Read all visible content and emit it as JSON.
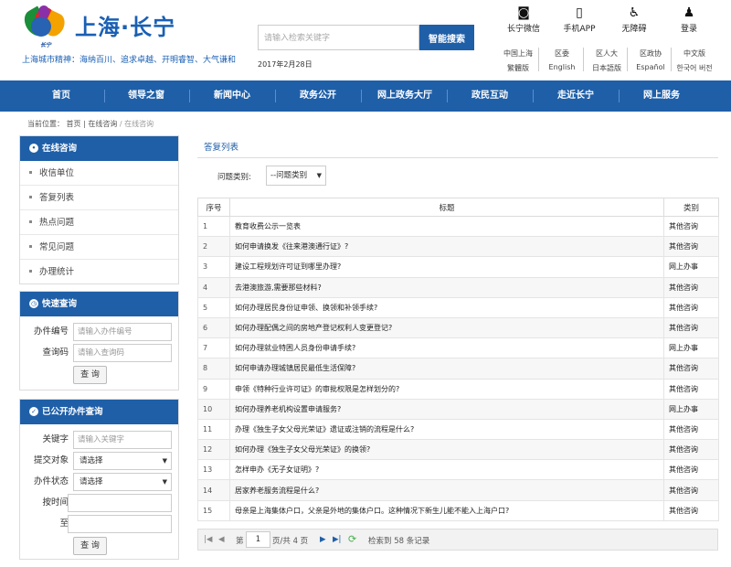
{
  "header": {
    "logo_brand": "长宁",
    "logo_text": "上海·长宁",
    "slogan": "上海城市精神：海纳百川、追求卓越、开明睿智、大气谦和",
    "search_placeholder": "请输入检索关键字",
    "search_button": "智能搜索",
    "date": "2017年2月28日",
    "top_icons": [
      {
        "label": "长宁微信",
        "icon": "wechat-icon"
      },
      {
        "label": "手机APP",
        "icon": "mobile-icon"
      },
      {
        "label": "无障碍",
        "icon": "accessibility-icon"
      },
      {
        "label": "登录",
        "icon": "user-icon"
      }
    ],
    "links_row1": [
      "中国上海",
      "区委",
      "区人大",
      "区政协",
      "中文版"
    ],
    "links_row2": [
      "繁體版",
      "English",
      "日本語版",
      "Español",
      "한국어 버전"
    ]
  },
  "nav": [
    "首页",
    "领导之窗",
    "新闻中心",
    "政务公开",
    "网上政务大厅",
    "政民互动",
    "走近长宁",
    "网上服务"
  ],
  "breadcrumb": {
    "prefix": "当前位置：",
    "items": [
      "首页",
      "在线咨询",
      "在线咨询"
    ]
  },
  "sidebar": {
    "consult": {
      "title": "在线咨询",
      "items": [
        "收信单位",
        "答复列表",
        "热点问题",
        "常见问题",
        "办理统计"
      ]
    },
    "quick": {
      "title": "快速查询",
      "fields": [
        {
          "label": "办件编号",
          "placeholder": "请输入办件编号"
        },
        {
          "label": "查询码",
          "placeholder": "请输入查询码"
        }
      ],
      "button": "查 询"
    },
    "public": {
      "title": "已公开办件查询",
      "keyword_label": "关键字",
      "keyword_placeholder": "请输入关键字",
      "target_label": "提交对象",
      "target_value": "请选择",
      "status_label": "办件状态",
      "status_value": "请选择",
      "time_label": "按时间",
      "to_label": "至",
      "button": "查 询"
    }
  },
  "main": {
    "tab": "答复列表",
    "filter_label": "问题类别:",
    "filter_value": "--问题类别",
    "columns": [
      "序号",
      "标题",
      "类别"
    ],
    "rows": [
      {
        "no": "1",
        "title": "教育收费公示一览表",
        "cat": "其他咨询"
      },
      {
        "no": "2",
        "title": "如何申请换发《往来港澳通行证》?",
        "cat": "其他咨询"
      },
      {
        "no": "3",
        "title": "建设工程规划许可证到哪里办理?",
        "cat": "网上办事"
      },
      {
        "no": "4",
        "title": "去港澳旅游,需要那些材料?",
        "cat": "其他咨询"
      },
      {
        "no": "5",
        "title": "如何办理居民身份证申领、换领和补领手续?",
        "cat": "其他咨询"
      },
      {
        "no": "6",
        "title": "如何办理配偶之间的房地产登记权利人变更登记?",
        "cat": "其他咨询"
      },
      {
        "no": "7",
        "title": "如何办理就业特困人员身份申请手续?",
        "cat": "网上办事"
      },
      {
        "no": "8",
        "title": "如何申请办理城镇居民最低生活保障?",
        "cat": "其他咨询"
      },
      {
        "no": "9",
        "title": "申领《特种行业许可证》的审批权限是怎样划分的?",
        "cat": "其他咨询"
      },
      {
        "no": "10",
        "title": "如何办理养老机构设置申请服务?",
        "cat": "网上办事"
      },
      {
        "no": "11",
        "title": "办理《独生子女父母光荣证》遗证或注销的流程是什么?",
        "cat": "其他咨询"
      },
      {
        "no": "12",
        "title": "如何办理《独生子女父母光荣证》的换领?",
        "cat": "其他咨询"
      },
      {
        "no": "13",
        "title": "怎样申办《无子女证明》?",
        "cat": "其他咨询"
      },
      {
        "no": "14",
        "title": "居家养老服务流程是什么?",
        "cat": "其他咨询"
      },
      {
        "no": "15",
        "title": "母亲是上海集体户口，父亲是外地的集体户口。这种情况下新生儿能不能入上海户口?",
        "cat": "其他咨询"
      }
    ],
    "pager": {
      "page_prefix": "第",
      "page": "1",
      "page_suffix": "页/共 4 页",
      "summary": "检索到 58 条记录"
    }
  }
}
